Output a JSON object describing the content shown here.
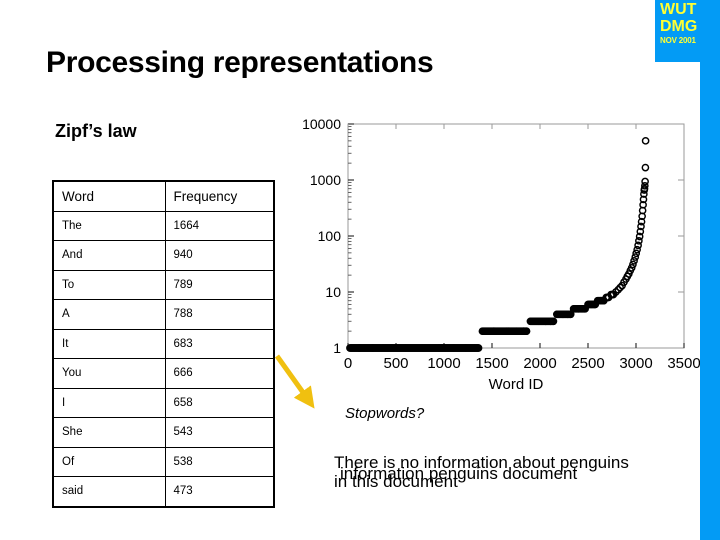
{
  "brand": {
    "line1": "WUT",
    "line2": "DMG",
    "date": "NOV 2001",
    "accent_color": "#039bf5",
    "text_color": "#ffff33"
  },
  "slide": {
    "title": "Processing representations",
    "section_heading": "Zipf’s law"
  },
  "table": {
    "headers": [
      "Word",
      "Frequency"
    ],
    "rows": [
      [
        "The",
        "1664"
      ],
      [
        "And",
        "940"
      ],
      [
        "To",
        "789"
      ],
      [
        "A",
        "788"
      ],
      [
        "It",
        "683"
      ],
      [
        "You",
        "666"
      ],
      [
        "I",
        "658"
      ],
      [
        "She",
        "543"
      ],
      [
        "Of",
        "538"
      ],
      [
        "said",
        "473"
      ]
    ]
  },
  "annotations": {
    "arrow_color": "#f0c010",
    "stopwords_caption": "Stopwords?",
    "sentence_full": "There is no information about penguins in this document",
    "sentence_keywords": "information penguins document"
  },
  "chart_data": {
    "type": "scatter",
    "title": "",
    "xlabel": "Word ID",
    "ylabel": "",
    "xlim": [
      0,
      3500
    ],
    "ylim": [
      1,
      10000
    ],
    "yscale": "log",
    "xticks": [
      0,
      500,
      1000,
      1500,
      2000,
      2500,
      3000,
      3500
    ],
    "xticklabels": [
      "0",
      "500",
      "1000",
      "1500",
      "2000",
      "2500",
      "3000",
      "3500"
    ],
    "yticks": [
      1,
      10,
      100,
      1000,
      10000
    ],
    "yticklabels": [
      "1",
      "10",
      "100",
      "1000",
      "10000"
    ],
    "grid": false,
    "legend": null,
    "marker": "open-circle",
    "description": "Zipf distribution: word frequency plotted against word rank ID, sorted ascending. Long flat plateaus at low frequencies for the many rare words, rising steeply near the high-frequency stopwords.",
    "points": [
      [
        20,
        1
      ],
      [
        120,
        1
      ],
      [
        260,
        1
      ],
      [
        420,
        1
      ],
      [
        600,
        1
      ],
      [
        780,
        1
      ],
      [
        950,
        1
      ],
      [
        1100,
        1
      ],
      [
        1230,
        1
      ],
      [
        1320,
        1
      ],
      [
        1360,
        1
      ],
      [
        1400,
        2
      ],
      [
        1520,
        2
      ],
      [
        1650,
        2
      ],
      [
        1760,
        2
      ],
      [
        1830,
        2
      ],
      [
        1860,
        2
      ],
      [
        1900,
        3
      ],
      [
        1990,
        3
      ],
      [
        2060,
        3
      ],
      [
        2110,
        3
      ],
      [
        2140,
        3
      ],
      [
        2175,
        4
      ],
      [
        2240,
        4
      ],
      [
        2290,
        4
      ],
      [
        2320,
        4
      ],
      [
        2350,
        5
      ],
      [
        2400,
        5
      ],
      [
        2440,
        5
      ],
      [
        2470,
        5
      ],
      [
        2500,
        6
      ],
      [
        2540,
        6
      ],
      [
        2575,
        6
      ],
      [
        2600,
        7
      ],
      [
        2635,
        7
      ],
      [
        2665,
        7
      ],
      [
        2690,
        8
      ],
      [
        2715,
        8
      ],
      [
        2740,
        9
      ],
      [
        2765,
        9
      ],
      [
        2790,
        10
      ],
      [
        2815,
        11
      ],
      [
        2835,
        12
      ],
      [
        2855,
        13
      ],
      [
        2875,
        15
      ],
      [
        2895,
        17
      ],
      [
        2910,
        19
      ],
      [
        2925,
        21
      ],
      [
        2940,
        24
      ],
      [
        2955,
        27
      ],
      [
        2968,
        31
      ],
      [
        2980,
        36
      ],
      [
        2992,
        42
      ],
      [
        3002,
        49
      ],
      [
        3012,
        57
      ],
      [
        3022,
        68
      ],
      [
        3030,
        82
      ],
      [
        3038,
        98
      ],
      [
        3045,
        120
      ],
      [
        3052,
        148
      ],
      [
        3058,
        180
      ],
      [
        3064,
        225
      ],
      [
        3069,
        285
      ],
      [
        3074,
        360
      ],
      [
        3078,
        450
      ],
      [
        3082,
        560
      ],
      [
        3086,
        660
      ],
      [
        3089,
        700
      ],
      [
        3092,
        789
      ],
      [
        3095,
        940
      ],
      [
        3098,
        1664
      ],
      [
        3100,
        5000
      ]
    ]
  }
}
